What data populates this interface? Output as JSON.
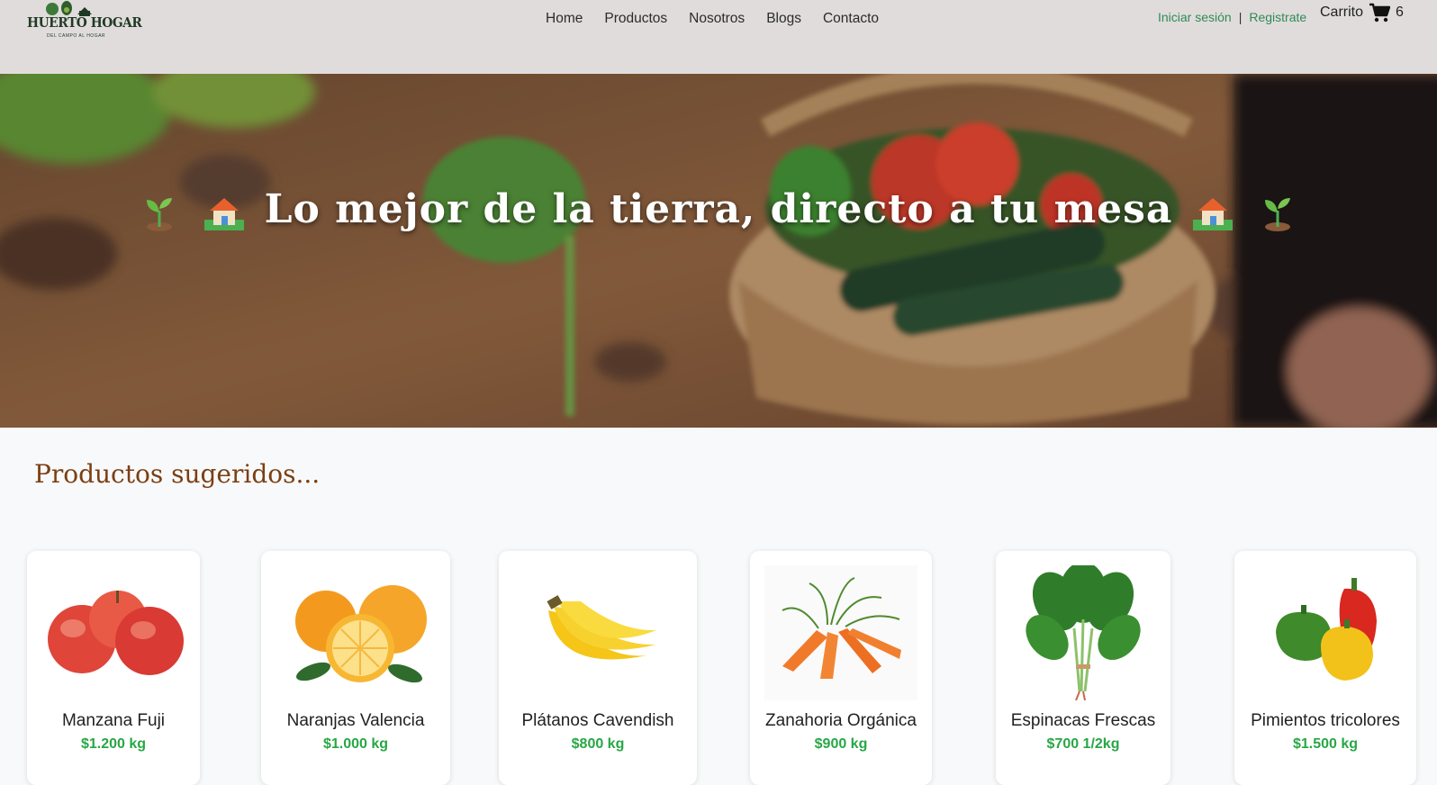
{
  "brand": {
    "name": "HUERTO HOGAR",
    "tagline": "DEL CAMPO AL HOGAR"
  },
  "nav": {
    "items": [
      "Home",
      "Productos",
      "Nosotros",
      "Blogs",
      "Contacto"
    ]
  },
  "auth": {
    "login": "Iniciar sesión",
    "separator": "|",
    "register": "Registrate"
  },
  "cart": {
    "label": "Carrito",
    "icon": "shopping-cart-icon",
    "count": "6"
  },
  "hero": {
    "title": "Lo mejor de la tierra, directo a tu mesa",
    "decorations": [
      "seedling-icon",
      "house-with-garden-icon"
    ]
  },
  "products": {
    "heading": "Productos sugeridos...",
    "items": [
      {
        "name": "Manzana Fuji",
        "price": "$1.200 kg",
        "image": "apples-image"
      },
      {
        "name": "Naranjas Valencia",
        "price": "$1.000 kg",
        "image": "oranges-image"
      },
      {
        "name": "Plátanos Cavendish",
        "price": "$800 kg",
        "image": "bananas-image"
      },
      {
        "name": "Zanahoria Orgánica",
        "price": "$900 kg",
        "image": "carrots-image"
      },
      {
        "name": "Espinacas Frescas",
        "price": "$700 1/2kg",
        "image": "spinach-image"
      },
      {
        "name": "Pimientos tricolores",
        "price": "$1.500 kg",
        "image": "peppers-image"
      }
    ]
  },
  "colors": {
    "header_bg": "#e1dcdc",
    "accent_green": "#2e8b57",
    "price_green": "#28a745",
    "heading_brown": "#7b3f12",
    "page_bg": "#f8f9fa"
  }
}
